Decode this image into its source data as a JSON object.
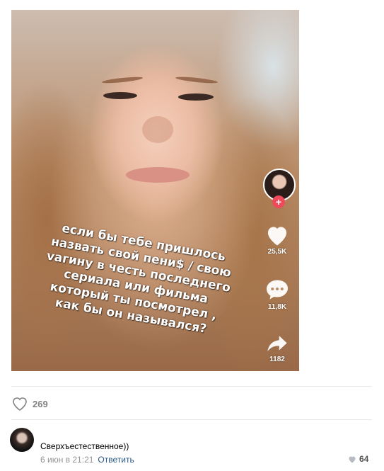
{
  "post": {
    "overlay_lines": [
      "если бы тебе пришлось",
      "назвать свой пени$ / свою",
      "vагину в честь последнего",
      "сериала или фильма",
      "который ты посмотрел ,",
      "как бы он назывался?"
    ],
    "side_actions": {
      "likes": "25,5K",
      "comments": "11,8K",
      "shares": "1182"
    },
    "like_count": "269"
  },
  "comment": {
    "text": "Сверхъестественное))",
    "date": "6 июн в 21:21",
    "reply_label": "Ответить",
    "likes": "64"
  },
  "icons": {
    "post_like": "heart-outline-icon",
    "tiktok_like": "heart-icon",
    "tiktok_comment": "speech-bubble-icon",
    "tiktok_share": "share-arrow-icon",
    "follow": "plus-icon",
    "comment_like": "heart-icon"
  },
  "colors": {
    "link": "#2a5885",
    "muted": "#828282",
    "divider": "#e7e8ec",
    "follow_badge": "#ef4a5b"
  }
}
